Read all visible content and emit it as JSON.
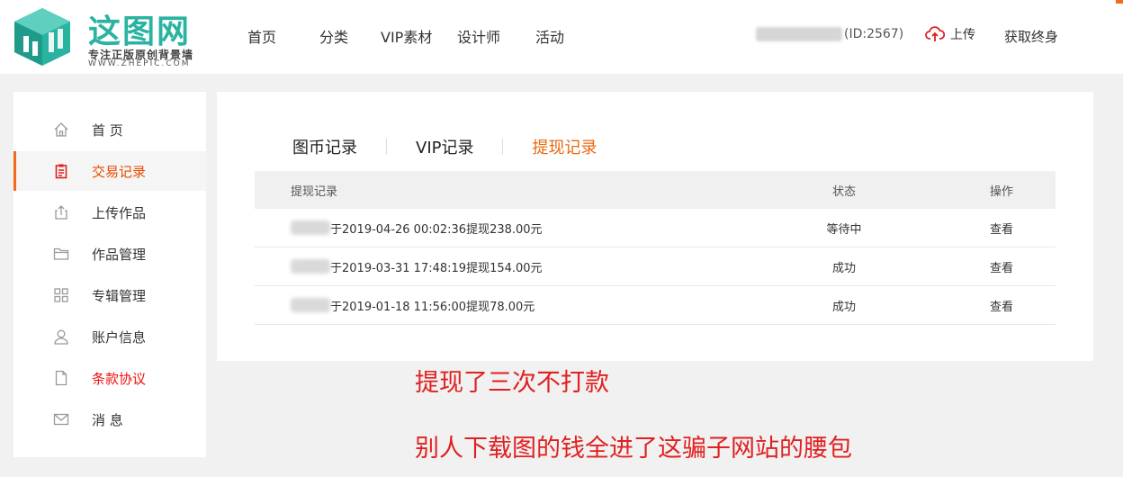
{
  "header": {
    "logo": {
      "title": "这图网",
      "slogan": "专注正版原创背景墙",
      "url": "WWW.ZHEPIC.COM"
    },
    "nav": [
      "首页",
      "分类",
      "VIP素材",
      "设计师",
      "活动"
    ],
    "user_id": "(ID:2567)",
    "upload_label": "上传",
    "lifetime_label": "获取终身"
  },
  "sidebar": {
    "items": [
      {
        "label": "首 页",
        "icon": "home-icon"
      },
      {
        "label": "交易记录",
        "icon": "clipboard-icon",
        "active": true
      },
      {
        "label": "上传作品",
        "icon": "upload-icon"
      },
      {
        "label": "作品管理",
        "icon": "folder-icon"
      },
      {
        "label": "专辑管理",
        "icon": "grid-icon"
      },
      {
        "label": "账户信息",
        "icon": "user-icon"
      },
      {
        "label": "条款协议",
        "icon": "document-icon"
      },
      {
        "label": "消 息",
        "icon": "mail-icon"
      }
    ]
  },
  "tabs": [
    "图币记录",
    "VIP记录",
    "提现记录"
  ],
  "table": {
    "headers": [
      "提现记录",
      "状态",
      "操作"
    ],
    "rows": [
      {
        "record": "于2019-04-26 00:02:36提现238.00元",
        "status": "等待中",
        "action": "查看"
      },
      {
        "record": "于2019-03-31 17:48:19提现154.00元",
        "status": "成功",
        "action": "查看"
      },
      {
        "record": "于2019-01-18 11:56:00提现78.00元",
        "status": "成功",
        "action": "查看"
      }
    ]
  },
  "annotations": [
    "提现了三次不打款",
    "别人下载图的钱全进了这骗子网站的腰包"
  ],
  "colors": {
    "accent": "#e8680c",
    "logo": "#2bb3a2",
    "annotation": "#e02020"
  }
}
